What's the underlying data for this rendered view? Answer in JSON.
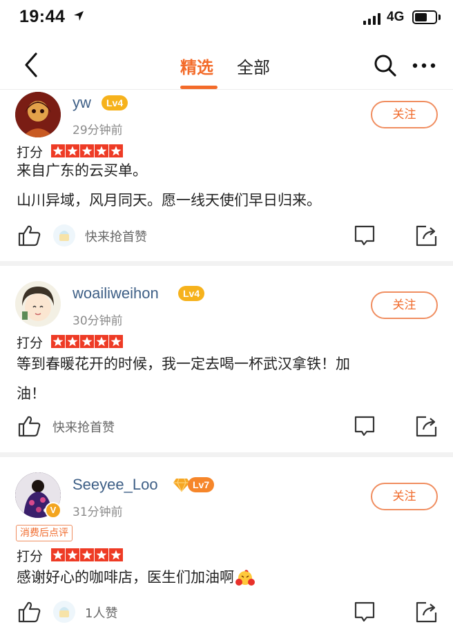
{
  "status_bar": {
    "time": "19:44",
    "network": "4G"
  },
  "nav": {
    "tabs": [
      {
        "label": "精选",
        "active": true
      },
      {
        "label": "全部",
        "active": false
      }
    ],
    "accent_color": "#f36b2a"
  },
  "posts": [
    {
      "username": "yw",
      "level": "Lv4",
      "time_ago": "29分钟前",
      "follow_label": "关注",
      "score_label": "打分",
      "rating": 5,
      "content_lines": [
        "来自广东的云买单。",
        "山川异域，风月同天。愿一线天使们早日归来。"
      ],
      "like_text": "快来抢首赞"
    },
    {
      "username": "woailiweihon",
      "level": "Lv4",
      "time_ago": "30分钟前",
      "follow_label": "关注",
      "score_label": "打分",
      "rating": 5,
      "content_lines": [
        "等到春暖花开的时候，我一定去喝一杯武汉拿铁！加",
        "油！"
      ],
      "like_text": "快来抢首赞"
    },
    {
      "username": "Seeyee_Loo",
      "level": "Lv7",
      "verified_badge": "V",
      "time_ago": "31分钟前",
      "follow_label": "关注",
      "tag": "消费后点评",
      "score_label": "打分",
      "rating": 5,
      "content_lines": [
        "感谢好心的咖啡店，医生们加油啊"
      ],
      "like_text": "1人赞"
    }
  ]
}
